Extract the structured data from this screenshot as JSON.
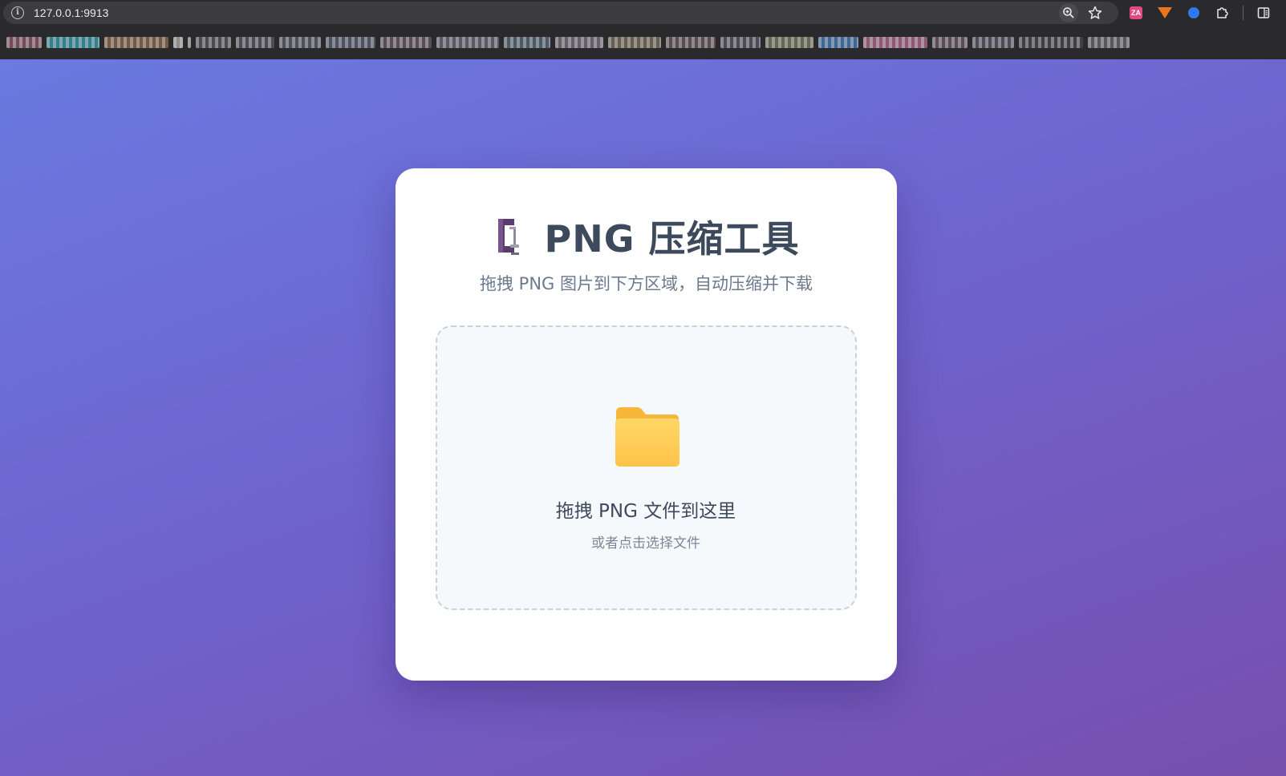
{
  "browser": {
    "url": "127.0.0.1:9913",
    "extension_a_label": "ZA"
  },
  "card": {
    "icon": "clamp-icon",
    "title": "PNG 压缩工具",
    "subtitle": "拖拽 PNG 图片到下方区域，自动压缩并下载"
  },
  "dropzone": {
    "icon": "folder-icon",
    "title": "拖拽 PNG 文件到这里",
    "subtitle": "或者点击选择文件"
  },
  "colors": {
    "background_start": "#6a7ae0",
    "background_end": "#774fae",
    "title": "#3d4a5c",
    "subtitle": "#6b7a8f",
    "folder": "#ffc94a"
  }
}
